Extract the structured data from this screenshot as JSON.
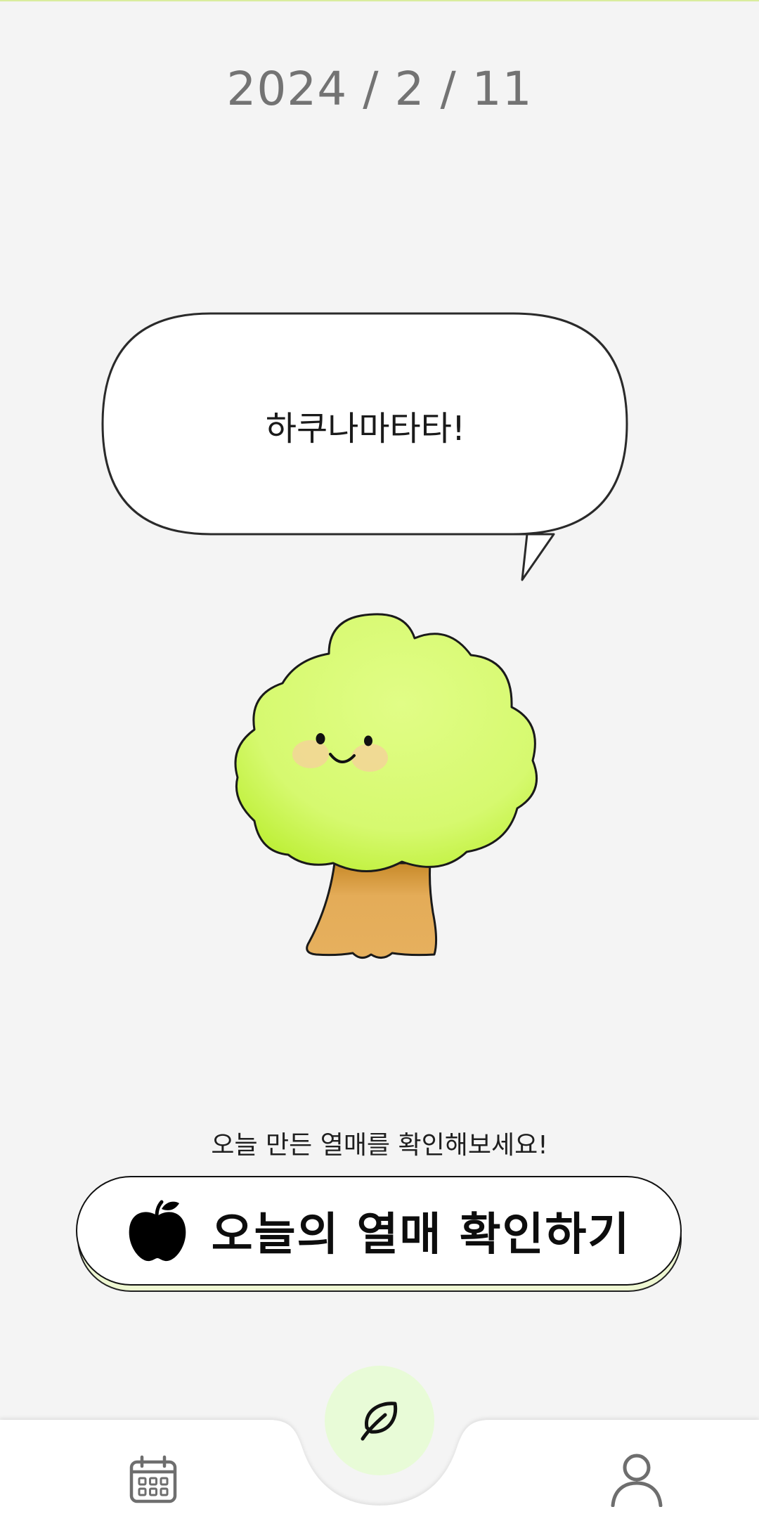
{
  "header": {
    "date": "2024 / 2 / 11"
  },
  "speech_bubble": {
    "text": "하쿠나마타타!"
  },
  "character": {
    "name": "tree-character"
  },
  "main": {
    "hint_text": "오늘 만든 열매를 확인해보세요!",
    "cta_label": "오늘의 열매 확인하기",
    "cta_icon": "apple-icon"
  },
  "navbar": {
    "items": [
      {
        "icon": "calendar-icon"
      },
      {
        "icon": "leaf-icon"
      },
      {
        "icon": "user-icon"
      }
    ]
  },
  "colors": {
    "background": "#f4f4f4",
    "foliage": "#dcfb7a",
    "trunk": "#e4ac58",
    "fab": "#e8fbd7"
  }
}
